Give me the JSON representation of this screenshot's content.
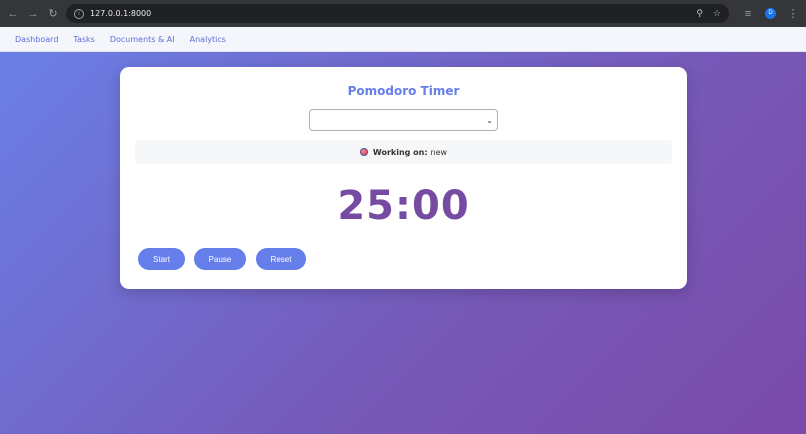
{
  "browser": {
    "url": "127.0.0.1:8000",
    "profile_initial": "D"
  },
  "nav": {
    "items": [
      "Dashboard",
      "Tasks",
      "Documents & AI",
      "Analytics"
    ]
  },
  "timer_card": {
    "title": "Pomodoro Timer",
    "task_select_value": "",
    "working_label": "Working on:",
    "working_task": "new",
    "time": "25:00",
    "buttons": {
      "start": "Start",
      "pause": "Pause",
      "reset": "Reset"
    }
  },
  "colors": {
    "accent": "#667eea",
    "timer": "#764ba2"
  },
  "icons": [
    "back-arrow-icon",
    "forward-arrow-icon",
    "reload-icon",
    "info-icon",
    "zoom-icon",
    "star-icon",
    "tab-search-icon",
    "menu-dots-icon",
    "tomato-icon",
    "chevron-down-icon"
  ]
}
